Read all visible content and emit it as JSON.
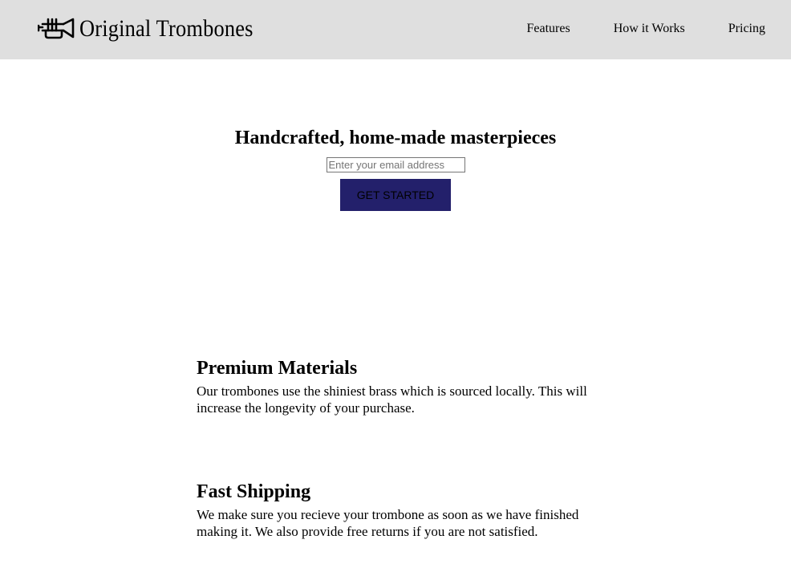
{
  "header": {
    "brand_name": "Original Trombones",
    "logo_icon": "trumpet-icon",
    "background": "#dfdfdf",
    "nav": [
      {
        "label": "Features"
      },
      {
        "label": "How it Works"
      },
      {
        "label": "Pricing"
      }
    ]
  },
  "hero": {
    "title": "Handcrafted, home-made masterpieces",
    "email_placeholder": "Enter your email address",
    "email_value": "",
    "button_label": "GET STARTED",
    "button_color": "#23206b"
  },
  "features": [
    {
      "title": "Premium Materials",
      "text": "Our trombones use the shiniest brass which is sourced locally. This will increase the longevity of your purchase."
    },
    {
      "title": "Fast Shipping",
      "text": "We make sure you recieve your trombone as soon as we have finished making it. We also provide free returns if you are not satisfied."
    }
  ]
}
